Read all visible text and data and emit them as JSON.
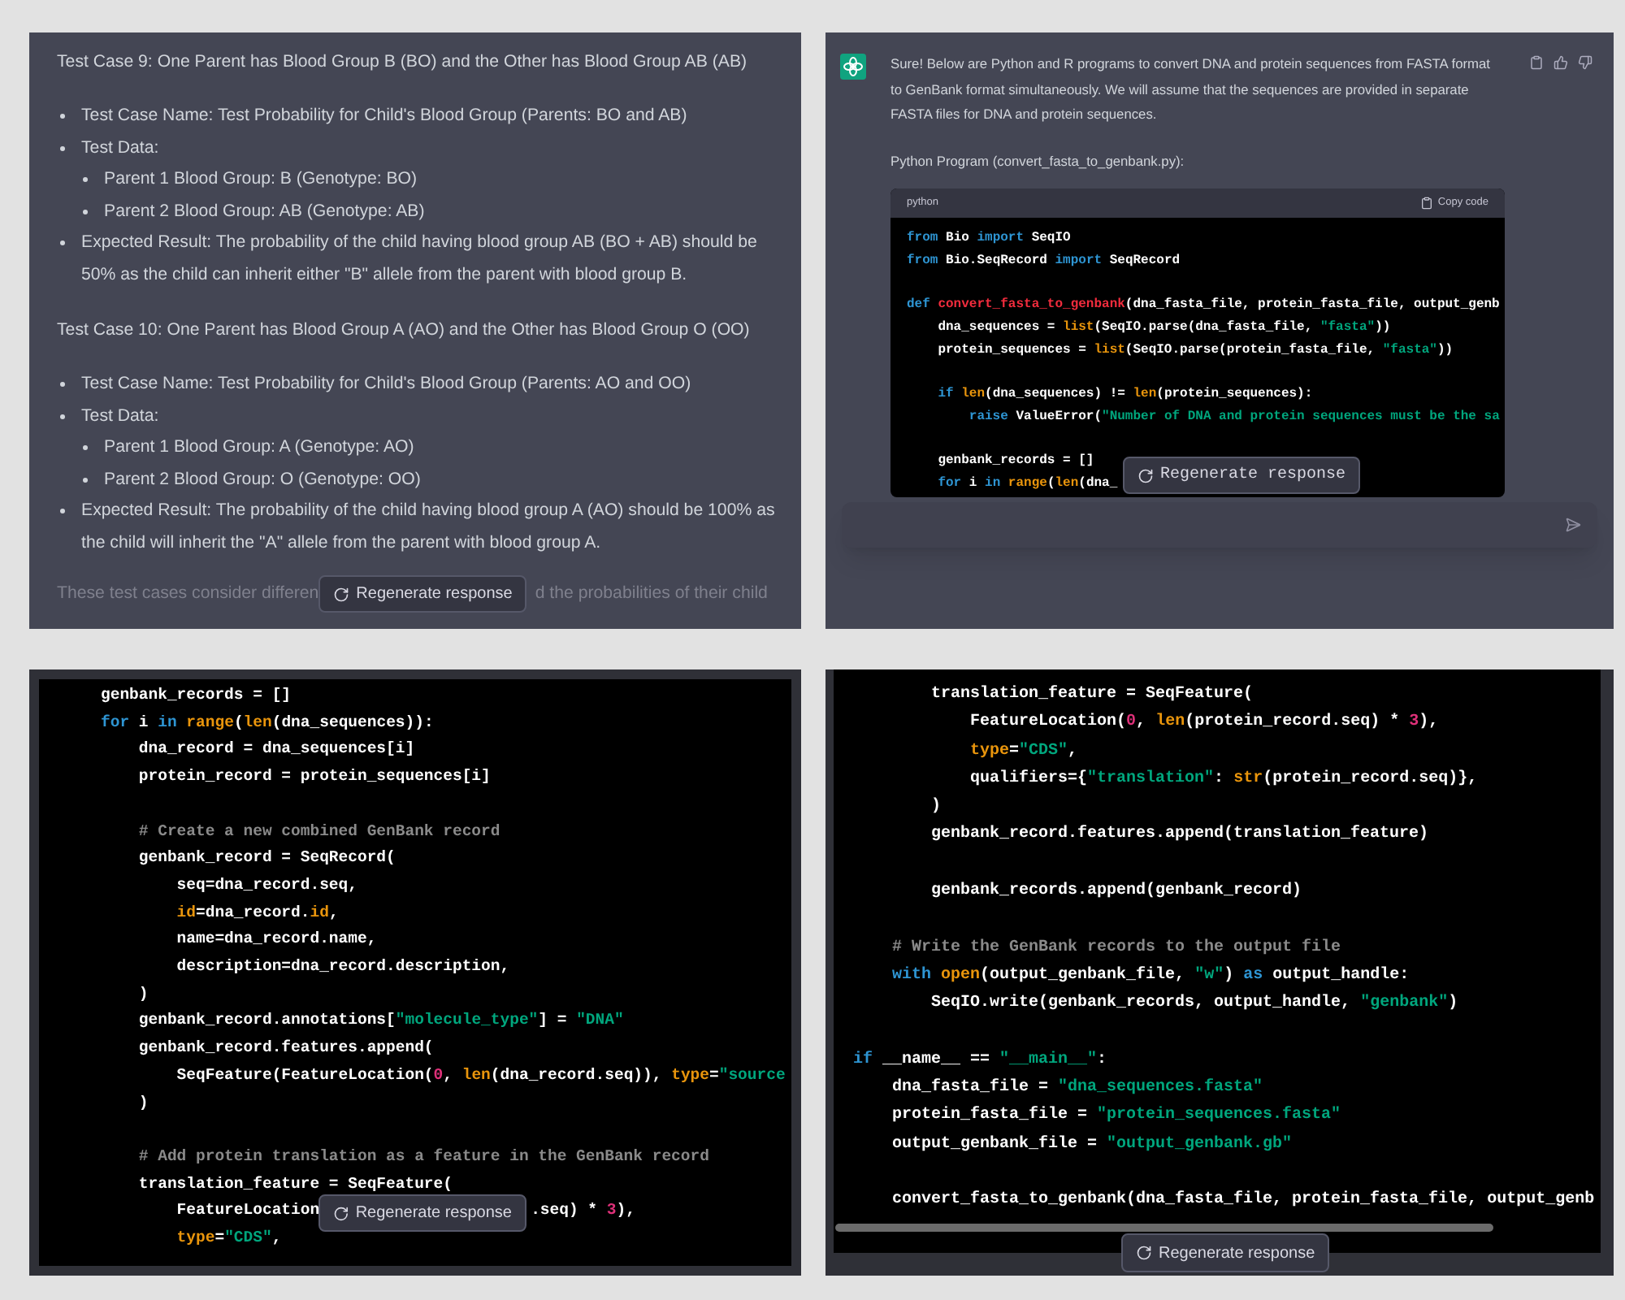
{
  "panels": [
    {
      "kind": "answer_text",
      "blocks": [
        {
          "kind": "heading",
          "text": "Test Case 9: One Parent has Blood Group B (BO) and the Other has Blood Group AB (AB)"
        },
        {
          "kind": "bullet",
          "text": "Test Case Name: Test Probability for Child's Blood Group (Parents: BO and AB)"
        },
        {
          "kind": "bullet",
          "text": "Test Data:",
          "children": [
            {
              "text": "Parent 1 Blood Group: B (Genotype: BO)"
            },
            {
              "text": "Parent 2 Blood Group: AB (Genotype: AB)"
            }
          ]
        },
        {
          "kind": "bullet",
          "text": "Expected Result: The probability of the child having blood group AB (BO + AB) should be 50% as the child can inherit either \"B\" allele from the parent with blood group B."
        },
        {
          "kind": "heading",
          "text": "Test Case 10: One Parent has Blood Group A (AO) and the Other has Blood Group O (OO)"
        },
        {
          "kind": "bullet",
          "text": "Test Case Name: Test Probability for Child's Blood Group (Parents: AO and OO)"
        },
        {
          "kind": "bullet",
          "text": "Test Data:",
          "children": [
            {
              "text": "Parent 1 Blood Group: A (Genotype: AO)"
            },
            {
              "text": "Parent 2 Blood Group: O (Genotype: OO)"
            }
          ]
        },
        {
          "kind": "bullet",
          "text": "Expected Result: The probability of the child having blood group A (AO) should be 100% as the child will inherit the \"A\" allele from the parent with blood group A."
        }
      ],
      "footer": {
        "left": "These test cases consider differen",
        "right": "d the probabilities of their child"
      },
      "regenerate_button": "Regenerate response"
    },
    {
      "kind": "answer_code",
      "intro": "Sure! Below are Python and R programs to convert DNA and protein sequences from FASTA format to GenBank format simultaneously. We will assume that the sequences are provided in separate FASTA files for DNA and protein sequences.",
      "program_title": "Python Program (convert_fasta_to_genbank.py):",
      "code_block": {
        "language": "python",
        "copy_button": "Copy code",
        "lines": [
          {
            "tokens": [
              {
                "kind": "k",
                "text": "from "
              },
              {
                "kind": "p",
                "text": "Bio "
              },
              {
                "kind": "k",
                "text": "import "
              },
              {
                "kind": "p",
                "text": "SeqIO"
              }
            ]
          },
          {
            "tokens": [
              {
                "kind": "k",
                "text": "from "
              },
              {
                "kind": "p",
                "text": "Bio.SeqRecord "
              },
              {
                "kind": "k",
                "text": "import "
              },
              {
                "kind": "p",
                "text": "SeqRecord"
              }
            ]
          },
          {
            "gap_before": true,
            "tokens": [
              {
                "kind": "k",
                "text": "def "
              },
              {
                "kind": "t",
                "text": "convert_fasta_to_genbank"
              },
              {
                "kind": "p",
                "text": "(dna_fasta_file, protein_fasta_file, output_genb"
              }
            ]
          },
          {
            "tokens": [
              {
                "kind": "p",
                "text": "    dna_sequences = "
              },
              {
                "kind": "b",
                "text": "list"
              },
              {
                "kind": "p",
                "text": "(SeqIO.parse(dna_fasta_file, "
              },
              {
                "kind": "s",
                "text": "\"fasta\""
              },
              {
                "kind": "p",
                "text": "))"
              }
            ]
          },
          {
            "tokens": [
              {
                "kind": "p",
                "text": "    protein_sequences = "
              },
              {
                "kind": "b",
                "text": "list"
              },
              {
                "kind": "p",
                "text": "(SeqIO.parse(protein_fasta_file, "
              },
              {
                "kind": "s",
                "text": "\"fasta\""
              },
              {
                "kind": "p",
                "text": "))"
              }
            ]
          },
          {
            "gap_before": true,
            "tokens": [
              {
                "kind": "k",
                "text": "    if "
              },
              {
                "kind": "b",
                "text": "len"
              },
              {
                "kind": "p",
                "text": "(dna_sequences) != "
              },
              {
                "kind": "b",
                "text": "len"
              },
              {
                "kind": "p",
                "text": "(protein_sequences):"
              }
            ]
          },
          {
            "tokens": [
              {
                "kind": "k",
                "text": "        raise "
              },
              {
                "kind": "p",
                "text": "ValueError("
              },
              {
                "kind": "s",
                "text": "\"Number of DNA and protein sequences must be the sa"
              }
            ]
          },
          {
            "gap_before": true,
            "tokens": [
              {
                "kind": "p",
                "text": "    genbank_records = []"
              }
            ]
          },
          {
            "tokens": [
              {
                "kind": "k",
                "text": "    for "
              },
              {
                "kind": "p",
                "text": "i "
              },
              {
                "kind": "k",
                "text": "in "
              },
              {
                "kind": "b",
                "text": "range"
              },
              {
                "kind": "p",
                "text": "("
              },
              {
                "kind": "b",
                "text": "len"
              },
              {
                "kind": "p",
                "text": "(dna_"
              }
            ]
          }
        ]
      },
      "regenerate_button": "Regenerate response"
    },
    {
      "kind": "code",
      "lines": [
        {
          "tokens": [
            {
              "kind": "p",
              "text": "genbank_records = []"
            }
          ]
        },
        {
          "tokens": [
            {
              "kind": "k",
              "text": "for "
            },
            {
              "kind": "p",
              "text": "i "
            },
            {
              "kind": "k",
              "text": "in "
            },
            {
              "kind": "b",
              "text": "range"
            },
            {
              "kind": "p",
              "text": "("
            },
            {
              "kind": "b",
              "text": "len"
            },
            {
              "kind": "p",
              "text": "(dna_sequences)):"
            }
          ]
        },
        {
          "tokens": [
            {
              "kind": "p",
              "text": "    dna_record = dna_sequences[i]"
            }
          ]
        },
        {
          "tokens": [
            {
              "kind": "p",
              "text": "    protein_record = protein_sequences[i]"
            }
          ]
        },
        {
          "gap_before": true,
          "tokens": [
            {
              "kind": "c",
              "text": "    # Create a new combined GenBank record"
            }
          ]
        },
        {
          "tokens": [
            {
              "kind": "p",
              "text": "    genbank_record = SeqRecord("
            }
          ]
        },
        {
          "tokens": [
            {
              "kind": "p",
              "text": "        seq=dna_record.seq,"
            }
          ]
        },
        {
          "tokens": [
            {
              "kind": "a",
              "text": "        id"
            },
            {
              "kind": "p",
              "text": "=dna_record."
            },
            {
              "kind": "a",
              "text": "id"
            },
            {
              "kind": "p",
              "text": ","
            }
          ]
        },
        {
          "tokens": [
            {
              "kind": "p",
              "text": "        name=dna_record.name,"
            }
          ]
        },
        {
          "tokens": [
            {
              "kind": "p",
              "text": "        description=dna_record.description,"
            }
          ]
        },
        {
          "tokens": [
            {
              "kind": "p",
              "text": "    )"
            }
          ]
        },
        {
          "tokens": [
            {
              "kind": "p",
              "text": "    genbank_record.annotations["
            },
            {
              "kind": "s",
              "text": "\"molecule_type\""
            },
            {
              "kind": "p",
              "text": "] = "
            },
            {
              "kind": "s",
              "text": "\"DNA\""
            }
          ]
        },
        {
          "tokens": [
            {
              "kind": "p",
              "text": "    genbank_record.features.append("
            }
          ]
        },
        {
          "tokens": [
            {
              "kind": "p",
              "text": "        SeqFeature(FeatureLocation("
            },
            {
              "kind": "n",
              "text": "0"
            },
            {
              "kind": "p",
              "text": ", "
            },
            {
              "kind": "b",
              "text": "len"
            },
            {
              "kind": "p",
              "text": "(dna_record.seq)), "
            },
            {
              "kind": "a",
              "text": "type"
            },
            {
              "kind": "p",
              "text": "="
            },
            {
              "kind": "s",
              "text": "\"source"
            }
          ]
        },
        {
          "tokens": [
            {
              "kind": "p",
              "text": "    )"
            }
          ]
        },
        {
          "gap_before": true,
          "tokens": [
            {
              "kind": "c",
              "text": "    # Add protein translation as a feature in the GenBank record"
            }
          ]
        },
        {
          "tokens": [
            {
              "kind": "p",
              "text": "    translation_feature = SeqFeature("
            }
          ]
        },
        {
          "tokens": [
            {
              "kind": "p",
              "text": "        FeatureLocation"
            },
            {
              "kind": "gap"
            },
            {
              "kind": "p",
              "text": ".seq) * "
            },
            {
              "kind": "n",
              "text": "3"
            },
            {
              "kind": "p",
              "text": "),"
            }
          ]
        },
        {
          "tokens": [
            {
              "kind": "a",
              "text": "        type"
            },
            {
              "kind": "p",
              "text": "="
            },
            {
              "kind": "s",
              "text": "\"CDS\""
            },
            {
              "kind": "p",
              "text": ","
            }
          ]
        }
      ],
      "regenerate_button": "Regenerate response"
    },
    {
      "kind": "code_scrolled",
      "lines": [
        {
          "tokens": [
            {
              "kind": "p",
              "text": "        translation_feature = SeqFeature("
            }
          ]
        },
        {
          "tokens": [
            {
              "kind": "p",
              "text": "            FeatureLocation("
            },
            {
              "kind": "n",
              "text": "0"
            },
            {
              "kind": "p",
              "text": ", "
            },
            {
              "kind": "b",
              "text": "len"
            },
            {
              "kind": "p",
              "text": "(protein_record.seq) * "
            },
            {
              "kind": "n",
              "text": "3"
            },
            {
              "kind": "p",
              "text": "),"
            }
          ]
        },
        {
          "tokens": [
            {
              "kind": "a",
              "text": "            type"
            },
            {
              "kind": "p",
              "text": "="
            },
            {
              "kind": "s",
              "text": "\"CDS\""
            },
            {
              "kind": "p",
              "text": ","
            }
          ]
        },
        {
          "tokens": [
            {
              "kind": "p",
              "text": "            qualifiers={"
            },
            {
              "kind": "s",
              "text": "\"translation\""
            },
            {
              "kind": "p",
              "text": ": "
            },
            {
              "kind": "b",
              "text": "str"
            },
            {
              "kind": "p",
              "text": "(protein_record.seq)},"
            }
          ]
        },
        {
          "tokens": [
            {
              "kind": "p",
              "text": "        )"
            }
          ]
        },
        {
          "tokens": [
            {
              "kind": "p",
              "text": "        genbank_record.features.append(translation_feature)"
            }
          ]
        },
        {
          "gap_before": true,
          "tokens": [
            {
              "kind": "p",
              "text": "        genbank_records.append(genbank_record)"
            }
          ]
        },
        {
          "gap_before": true,
          "tokens": [
            {
              "kind": "c",
              "text": "    # Write the GenBank records to the output file"
            }
          ]
        },
        {
          "tokens": [
            {
              "kind": "k",
              "text": "    with "
            },
            {
              "kind": "b",
              "text": "open"
            },
            {
              "kind": "p",
              "text": "(output_genbank_file, "
            },
            {
              "kind": "s",
              "text": "\"w\""
            },
            {
              "kind": "p",
              "text": ") "
            },
            {
              "kind": "k",
              "text": "as "
            },
            {
              "kind": "p",
              "text": "output_handle:"
            }
          ]
        },
        {
          "tokens": [
            {
              "kind": "p",
              "text": "        SeqIO.write(genbank_records, output_handle, "
            },
            {
              "kind": "s",
              "text": "\"genbank\""
            },
            {
              "kind": "p",
              "text": ")"
            }
          ]
        },
        {
          "gap_before": true,
          "tokens": [
            {
              "kind": "k",
              "text": "if "
            },
            {
              "kind": "p",
              "text": "__name__ == "
            },
            {
              "kind": "s",
              "text": "\"__main__\""
            },
            {
              "kind": "p",
              "text": ":"
            }
          ]
        },
        {
          "tokens": [
            {
              "kind": "p",
              "text": "    dna_fasta_file = "
            },
            {
              "kind": "s",
              "text": "\"dna_sequences.fasta\""
            }
          ]
        },
        {
          "tokens": [
            {
              "kind": "p",
              "text": "    protein_fasta_file = "
            },
            {
              "kind": "s",
              "text": "\"protein_sequences.fasta\""
            }
          ]
        },
        {
          "tokens": [
            {
              "kind": "p",
              "text": "    output_genbank_file = "
            },
            {
              "kind": "s",
              "text": "\"output_genbank.gb\""
            }
          ]
        },
        {
          "gap_before": true,
          "tokens": [
            {
              "kind": "p",
              "text": "    convert_fasta_to_genbank(dna_fasta_file, protein_fasta_file, output_genb"
            }
          ]
        }
      ],
      "regenerate_button": "Regenerate response"
    }
  ]
}
